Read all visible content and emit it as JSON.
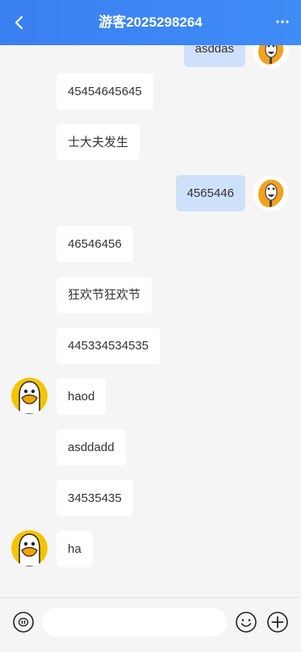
{
  "header": {
    "title": "游客2025298264"
  },
  "messages": [
    {
      "from": "me",
      "text": "asddas"
    },
    {
      "from": "other",
      "text": "45454645645"
    },
    {
      "from": "other",
      "text": "士大夫发生"
    },
    {
      "from": "me",
      "text": "4565446"
    },
    {
      "from": "other",
      "text": "46546456"
    },
    {
      "from": "other",
      "text": "狂欢节狂欢节"
    },
    {
      "from": "other",
      "text": "445334534535"
    },
    {
      "from": "other",
      "text": "haod"
    },
    {
      "from": "other",
      "text": "asddadd"
    },
    {
      "from": "other",
      "text": "34535435"
    },
    {
      "from": "other",
      "text": "ha"
    }
  ],
  "footer": {
    "input_value": "",
    "input_placeholder": ""
  },
  "colors": {
    "header": "#3a7ff0",
    "my_bubble": "#cfe0fb",
    "other_bubble": "#ffffff",
    "background": "#f5f5f5"
  },
  "icons": [
    "back-icon",
    "more-icon",
    "voice-icon",
    "emoji-icon",
    "add-icon"
  ]
}
